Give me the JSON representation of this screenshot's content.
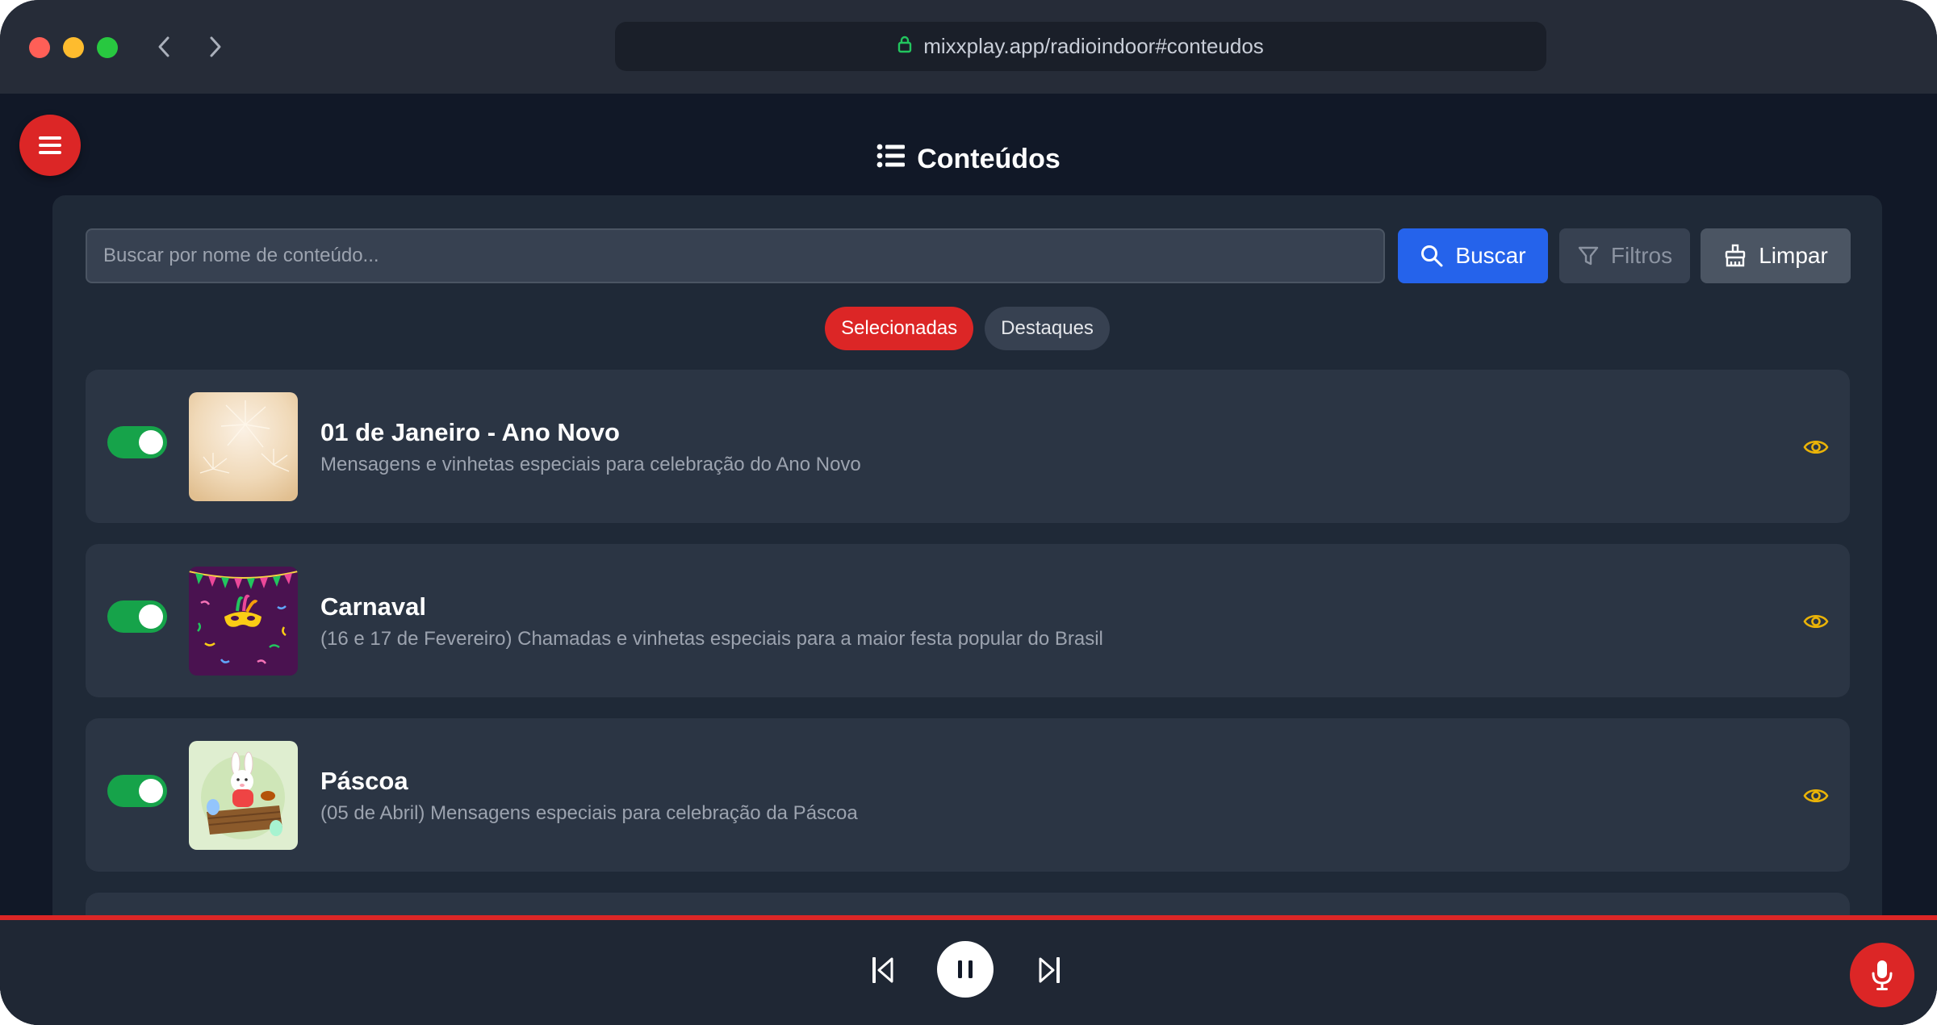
{
  "browser": {
    "url": "mixxplay.app/radioindoor#conteudos"
  },
  "page": {
    "title": "Conteúdos"
  },
  "search": {
    "placeholder": "Buscar por nome de conteúdo...",
    "value": "",
    "buscar_label": "Buscar",
    "filtros_label": "Filtros",
    "limpar_label": "Limpar"
  },
  "tabs": [
    {
      "label": "Selecionadas",
      "active": true
    },
    {
      "label": "Destaques",
      "active": false
    }
  ],
  "items": [
    {
      "title": "01 de Janeiro - Ano Novo",
      "description": "Mensagens e vinhetas especiais para celebração do Ano Novo",
      "enabled": true,
      "thumb": "fireworks"
    },
    {
      "title": "Carnaval",
      "description": "(16 e 17 de Fevereiro) Chamadas e vinhetas especiais para a maior festa popular do Brasil",
      "enabled": true,
      "thumb": "carnival-mask"
    },
    {
      "title": "Páscoa",
      "description": "(05 de Abril) Mensagens especiais para celebração da Páscoa",
      "enabled": true,
      "thumb": "easter-bunny"
    }
  ],
  "colors": {
    "accent": "#dc2626",
    "primary": "#2563eb",
    "toggle_on": "#16a34a",
    "eye_icon": "#eab308"
  }
}
